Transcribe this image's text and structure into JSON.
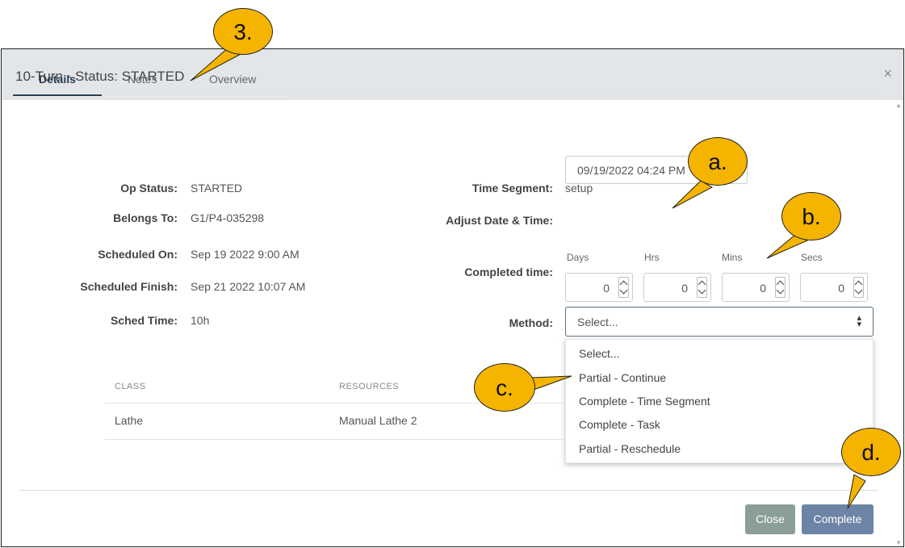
{
  "modal": {
    "title": "10-Turn - Status: STARTED",
    "close_icon": "×"
  },
  "tabs": [
    {
      "label": "Details",
      "active": true
    },
    {
      "label": "Notes",
      "active": false
    },
    {
      "label": "Overview",
      "active": false
    }
  ],
  "details": {
    "op_status": {
      "label": "Op Status:",
      "value": "STARTED"
    },
    "belongs_to": {
      "label": "Belongs To:",
      "value": "G1/P4-035298"
    },
    "scheduled_on": {
      "label": "Scheduled On:",
      "value": "Sep 19 2022 9:00 AM"
    },
    "scheduled_finish": {
      "label": "Scheduled Finish:",
      "value": "Sep 21 2022 10:07 AM"
    },
    "sched_time": {
      "label": "Sched Time:",
      "value": "10h"
    }
  },
  "right": {
    "time_segment": {
      "label": "Time Segment:",
      "value": "setup"
    },
    "adjust_date": {
      "label": "Adjust Date & Time:",
      "value": "09/19/2022 04:24 PM"
    },
    "completed_time": {
      "label": "Completed time:",
      "units": [
        "Days",
        "Hrs",
        "Mins",
        "Secs"
      ],
      "values": [
        "0",
        "0",
        "0",
        "0"
      ]
    },
    "method": {
      "label": "Method:",
      "selected": "Select...",
      "options": [
        "Select...",
        "Partial - Continue",
        "Complete - Time Segment",
        "Complete - Task",
        "Partial - Reschedule"
      ]
    }
  },
  "table": {
    "headers": [
      "CLASS",
      "RESOURCES"
    ],
    "rows": [
      [
        "Lathe",
        "Manual Lathe 2"
      ]
    ]
  },
  "footer": {
    "close_label": "Close",
    "complete_label": "Complete"
  },
  "callouts": [
    "3.",
    "a.",
    "b.",
    "c.",
    "d."
  ],
  "colors": {
    "header_bg": "#e3e6e9",
    "callout": "#f4b400",
    "complete_button": "#6e84a6",
    "close_button": "#8b9e99",
    "active_tab": "#2c3e50"
  }
}
